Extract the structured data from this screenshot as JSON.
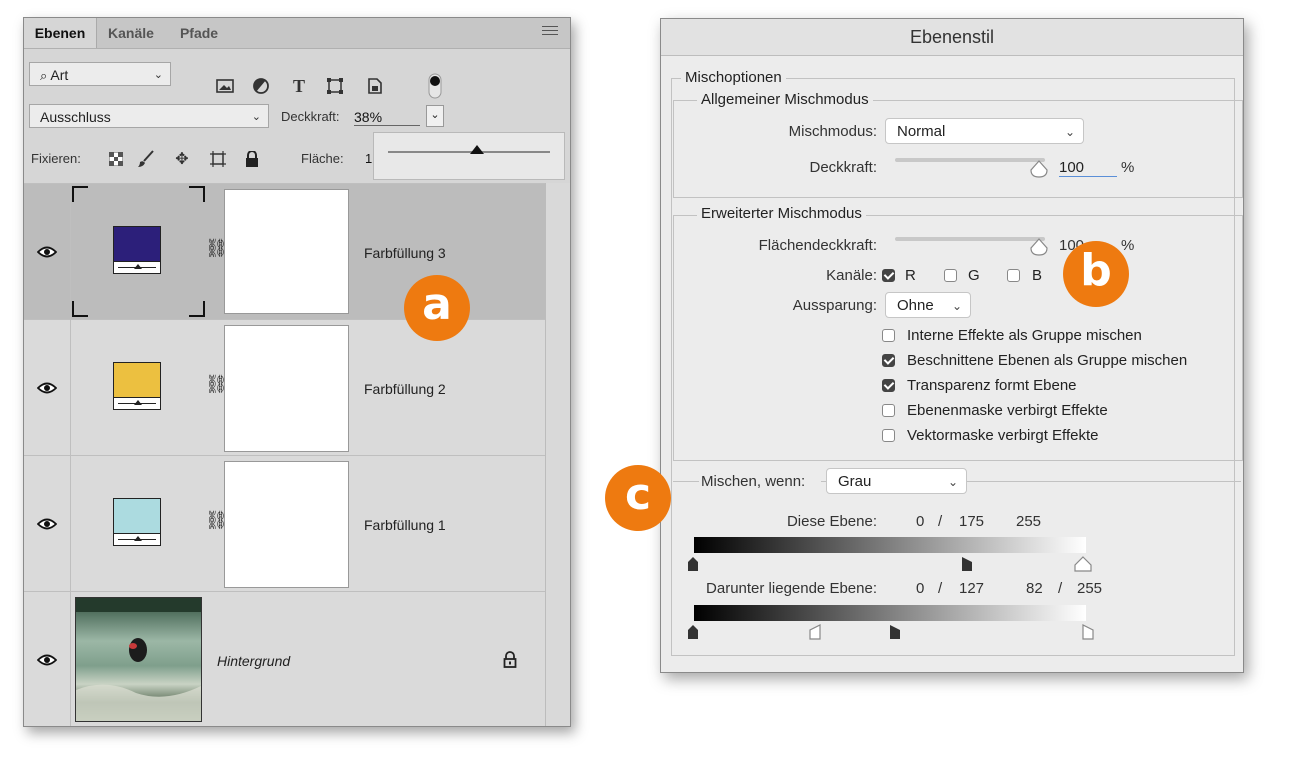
{
  "layers_panel": {
    "tabs": [
      "Ebenen",
      "Kanäle",
      "Pfade"
    ],
    "filter": {
      "label": "Art"
    },
    "blend_mode": "Ausschluss",
    "opacity_label": "Deckkraft:",
    "opacity_value": "38%",
    "opacity_slider_fraction": 0.38,
    "lock_label": "Fixieren:",
    "fill_label": "Fläche:",
    "fill_value": "1",
    "layers": [
      {
        "name": "Farbfüllung 3",
        "color": "#2c1f7a",
        "selected": true
      },
      {
        "name": "Farbfüllung 2",
        "color": "#ecc040",
        "selected": false
      },
      {
        "name": "Farbfüllung 1",
        "color": "#acdbe0",
        "selected": false
      },
      {
        "name": "Hintergrund",
        "locked": true
      }
    ]
  },
  "style_dialog": {
    "title": "Ebenenstil",
    "section_title": "Mischoptionen",
    "general": {
      "legend": "Allgemeiner Mischmodus",
      "blend_mode_label": "Mischmodus:",
      "blend_mode_value": "Normal",
      "opacity_label": "Deckkraft:",
      "opacity_value": "100",
      "unit": "%"
    },
    "advanced": {
      "legend": "Erweiterter Mischmodus",
      "fill_opacity_label": "Flächendeckkraft:",
      "fill_opacity_value": "100",
      "unit": "%",
      "channels_label": "Kanäle:",
      "channels": [
        {
          "label": "R",
          "checked": true
        },
        {
          "label": "G",
          "checked": false
        },
        {
          "label": "B",
          "checked": false
        }
      ],
      "knockout_label": "Aussparung:",
      "knockout_value": "Ohne",
      "options": [
        {
          "label": "Interne Effekte als Gruppe mischen",
          "checked": false
        },
        {
          "label": "Beschnittene Ebenen als Gruppe mischen",
          "checked": true
        },
        {
          "label": "Transparenz formt Ebene",
          "checked": true
        },
        {
          "label": "Ebenenmaske verbirgt Effekte",
          "checked": false
        },
        {
          "label": "Vektormaske verbirgt Effekte",
          "checked": false
        }
      ]
    },
    "blend_if": {
      "label": "Mischen, wenn:",
      "value": "Grau",
      "this_layer": {
        "label": "Diese Ebene:",
        "v1": "0",
        "sep": "/",
        "v2": "175",
        "v3": "255"
      },
      "underlying": {
        "label": "Darunter liegende Ebene:",
        "v1": "0",
        "sep1": "/",
        "v2": "127",
        "v3": "82",
        "sep2": "/",
        "v4": "255"
      }
    }
  },
  "badges": [
    "a",
    "b",
    "c"
  ],
  "accent_color": "#ee7a10"
}
